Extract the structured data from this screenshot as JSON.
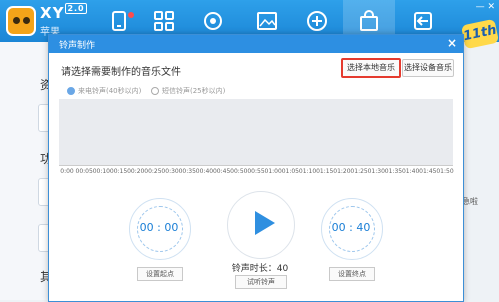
{
  "header": {
    "logo_title": "XY",
    "logo_version": "2.0",
    "logo_subtitle": "苹果",
    "badge": "11th",
    "window_controls": "— ✕"
  },
  "left_panel": {
    "labels": [
      "资",
      "功",
      "其"
    ]
  },
  "right_panel": {
    "text": "急啦"
  },
  "dialog": {
    "title": "铃声制作",
    "close": "×",
    "prompt": "请选择需要制作的音乐文件",
    "btn_local": "选择本地音乐",
    "btn_device": "选择设备音乐",
    "radio_incoming": "来电铃声(40秒以内)",
    "radio_sms": "短信铃声(25秒以内)",
    "timeline": [
      "0:00",
      "00:05",
      "00:10",
      "00:15",
      "00:20",
      "00:25",
      "00:30",
      "00:35",
      "00:40",
      "00:45",
      "00:50",
      "00:55",
      "01:00",
      "01:05",
      "01:10",
      "01:15",
      "01:20",
      "01:25",
      "01:30",
      "01:35",
      "01:40",
      "01:45",
      "01:50"
    ],
    "start_time": "00 : 00",
    "end_time": "00 : 40",
    "duration": "铃声时长：40秒",
    "btn_set_start": "设置起点",
    "btn_set_end": "设置终点",
    "btn_preview": "试听铃声"
  }
}
